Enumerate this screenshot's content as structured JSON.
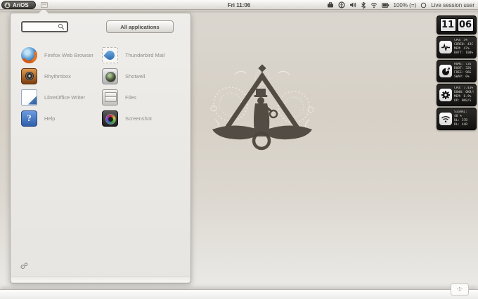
{
  "colors": {
    "desktop_top": "#dbd7d0",
    "desktop_mid": "#d6d0c6",
    "desktop_bottom": "#eae9e6",
    "panel_bg": "#efedea",
    "widget_bg": "#1a1916",
    "emblem": "#4b453d",
    "accent_text": "#454340"
  },
  "topbar": {
    "arios_label": "AriOS",
    "clock": "Fri 11:06",
    "battery_label": "100% (=)",
    "user_label": "Live session user",
    "tray_icons": [
      "input-source",
      "accessibility",
      "volume",
      "bluetooth",
      "wifi",
      "battery",
      "session"
    ]
  },
  "launcher": {
    "search_placeholder": "",
    "all_apps_label": "All applications",
    "apps": [
      {
        "id": "firefox",
        "name": "Firefox Web Browser"
      },
      {
        "id": "thunderbird",
        "name": "Thunderbird Mail"
      },
      {
        "id": "rhythmbox",
        "name": "Rhythmbox"
      },
      {
        "id": "shotwell",
        "name": "Shotwell"
      },
      {
        "id": "writer",
        "name": "LibreOffice Writer"
      },
      {
        "id": "files",
        "name": "Files"
      },
      {
        "id": "help",
        "name": "Help"
      },
      {
        "id": "screenshot",
        "name": "Screenshot"
      }
    ]
  },
  "widgets": {
    "clock": {
      "hour": "11",
      "minute": "06"
    },
    "system": {
      "icon": "heartbeat-icon",
      "lines": [
        "CPU: 5%",
        "CORE0: 43C",
        "MEM: 47%",
        "BATT: 100%"
      ]
    },
    "disk": {
      "icon": "pie-chart-icon",
      "lines": [
        "HOME: 72G",
        "ROOT: 32G",
        "FREE: 96G",
        "SWAP: 0%"
      ]
    },
    "process": {
      "icon": "gear-icon",
      "lines": [
        "CPU: 7.43%",
        "DOWN: 0KB/S",
        "MEM: 6.9%",
        "UP: 0KB/S"
      ]
    },
    "network": {
      "icon": "wifi-icon",
      "lines": [
        "SIGNAL:",
        "40 %",
        "UL: 37B",
        "DL: 44B"
      ]
    }
  },
  "workspace": {
    "label": "-1-"
  }
}
